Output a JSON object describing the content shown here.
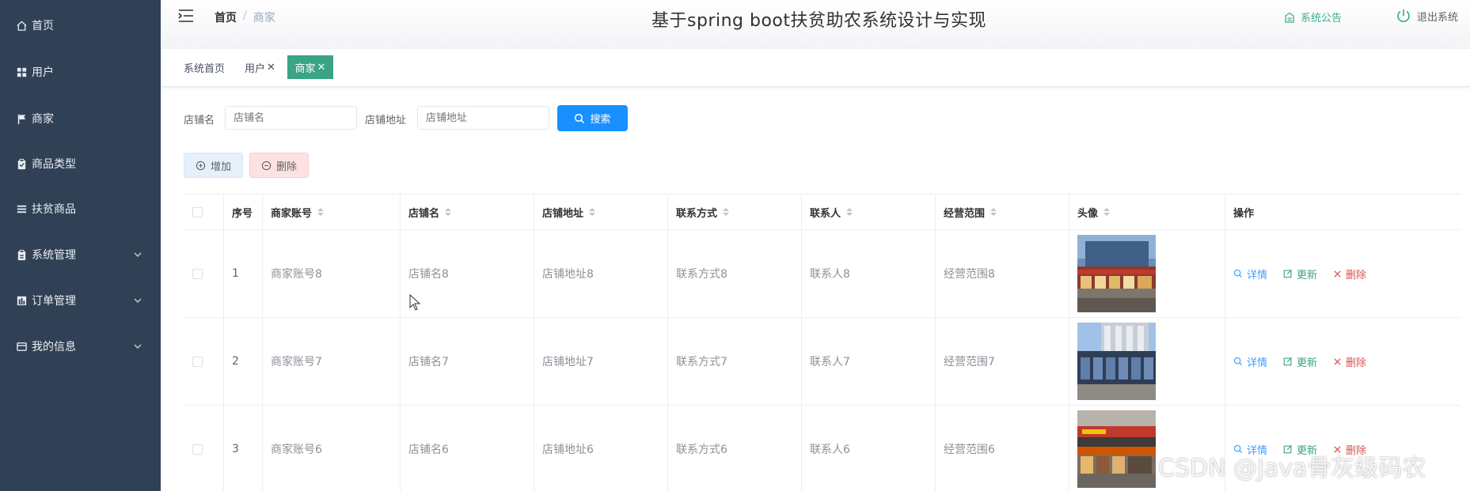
{
  "sidebar": {
    "items": [
      {
        "label": "首页",
        "icon": "home-icon"
      },
      {
        "label": "用户",
        "icon": "grid-icon"
      },
      {
        "label": "商家",
        "icon": "flag-icon"
      },
      {
        "label": "商品类型",
        "icon": "clipboard-icon"
      },
      {
        "label": "扶贫商品",
        "icon": "list-icon"
      },
      {
        "label": "系统管理",
        "icon": "clipboard-icon"
      },
      {
        "label": "订单管理",
        "icon": "chart-icon"
      },
      {
        "label": "我的信息",
        "icon": "card-icon"
      }
    ]
  },
  "header": {
    "breadcrumb": {
      "home": "首页",
      "separator": "/",
      "current": "商家"
    },
    "title": "基于spring boot扶贫助农系统设计与实现",
    "notice_label": "系统公告",
    "logout_label": "退出系统"
  },
  "tags": [
    {
      "label": "系统首页"
    },
    {
      "label": "用户",
      "close": "✕"
    },
    {
      "label": "商家",
      "close": "✕"
    }
  ],
  "search": {
    "shop_name_label": "店铺名",
    "shop_name_placeholder": "店铺名",
    "shop_address_label": "店铺地址",
    "shop_address_placeholder": "店铺地址",
    "button_label": "搜索"
  },
  "toolbar": {
    "add_label": "增加",
    "delete_label": "删除"
  },
  "table": {
    "headers": [
      "序号",
      "商家账号",
      "店铺名",
      "店铺地址",
      "联系方式",
      "联系人",
      "经营范围",
      "头像",
      "操作"
    ],
    "rows": [
      {
        "index": "1",
        "account": "商家账号8",
        "shop_name": "店铺名8",
        "address": "店铺地址8",
        "contact": "联系方式8",
        "person": "联系人8",
        "scope": "经营范围8"
      },
      {
        "index": "2",
        "account": "商家账号7",
        "shop_name": "店铺名7",
        "address": "店铺地址7",
        "contact": "联系方式7",
        "person": "联系人7",
        "scope": "经营范围7"
      },
      {
        "index": "3",
        "account": "商家账号6",
        "shop_name": "店铺名6",
        "address": "店铺地址6",
        "contact": "联系方式6",
        "person": "联系人6",
        "scope": "经营范围6"
      }
    ],
    "actions": {
      "detail": "详情",
      "update": "更新",
      "delete": "删除"
    }
  },
  "watermark": "CSDN @Java骨灰级码农",
  "colors": {
    "sidebar_bg": "#304156",
    "accent_green": "#3aa485",
    "primary_blue": "#1890ff",
    "danger_red": "#d9534f"
  }
}
